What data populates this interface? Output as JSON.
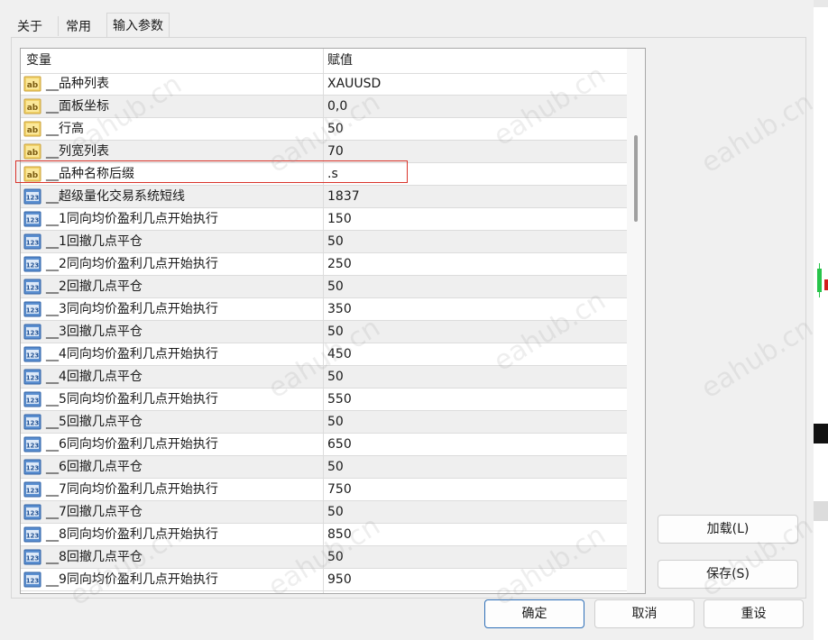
{
  "tabs": [
    {
      "label": "关于"
    },
    {
      "label": "常用"
    },
    {
      "label": "输入参数",
      "active": true
    }
  ],
  "grid": {
    "headers": {
      "variable": "变量",
      "value": "赋值"
    },
    "rows": [
      {
        "type": "ab",
        "name": "__品种列表",
        "value": "XAUUSD"
      },
      {
        "type": "ab",
        "name": "__面板坐标",
        "value": "0,0"
      },
      {
        "type": "ab",
        "name": "__行高",
        "value": "50"
      },
      {
        "type": "ab",
        "name": "__列宽列表",
        "value": "70"
      },
      {
        "type": "ab",
        "name": "__品种名称后缀",
        "value": ".s"
      },
      {
        "type": "123",
        "name": "__超级量化交易系统短线",
        "value": "1837"
      },
      {
        "type": "123",
        "name": "__1同向均价盈利几点开始执行",
        "value": "150"
      },
      {
        "type": "123",
        "name": "__1回撤几点平仓",
        "value": "50"
      },
      {
        "type": "123",
        "name": "__2同向均价盈利几点开始执行",
        "value": "250"
      },
      {
        "type": "123",
        "name": "__2回撤几点平仓",
        "value": "50"
      },
      {
        "type": "123",
        "name": "__3同向均价盈利几点开始执行",
        "value": "350"
      },
      {
        "type": "123",
        "name": "__3回撤几点平仓",
        "value": "50"
      },
      {
        "type": "123",
        "name": "__4同向均价盈利几点开始执行",
        "value": "450"
      },
      {
        "type": "123",
        "name": "__4回撤几点平仓",
        "value": "50"
      },
      {
        "type": "123",
        "name": "__5同向均价盈利几点开始执行",
        "value": "550"
      },
      {
        "type": "123",
        "name": "__5回撤几点平仓",
        "value": "50"
      },
      {
        "type": "123",
        "name": "__6同向均价盈利几点开始执行",
        "value": "650"
      },
      {
        "type": "123",
        "name": "__6回撤几点平仓",
        "value": "50"
      },
      {
        "type": "123",
        "name": "__7同向均价盈利几点开始执行",
        "value": "750"
      },
      {
        "type": "123",
        "name": "__7回撤几点平仓",
        "value": "50"
      },
      {
        "type": "123",
        "name": "__8同向均价盈利几点开始执行",
        "value": "850"
      },
      {
        "type": "123",
        "name": "__8回撤几点平仓",
        "value": "50"
      },
      {
        "type": "123",
        "name": "__9同向均价盈利几点开始执行",
        "value": "950"
      }
    ]
  },
  "side_buttons": {
    "load": "加载(L)",
    "save": "保存(S)"
  },
  "bottom_buttons": {
    "ok": "确定",
    "cancel": "取消",
    "reset": "重设"
  },
  "watermark": "eahub.cn",
  "icon_labels": {
    "ab": "ab",
    "num": "123"
  },
  "colors": {
    "highlight": "#d9342b",
    "default_button_border": "#2e6fb8"
  }
}
